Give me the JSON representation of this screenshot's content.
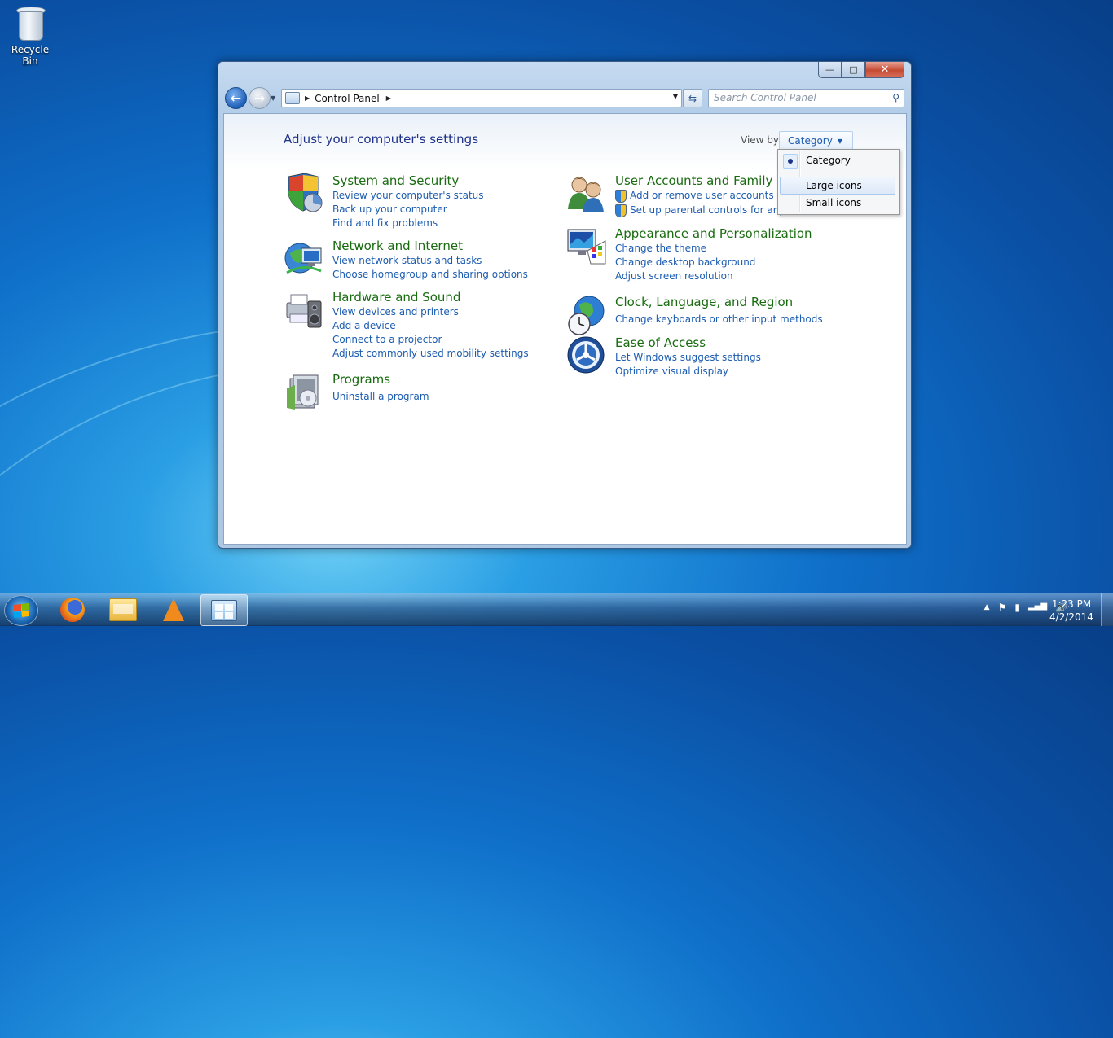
{
  "desktop": {
    "icons": [
      {
        "label": "Recycle Bin",
        "icon": "recycle-bin-icon"
      }
    ]
  },
  "window": {
    "caption_buttons": {
      "minimize": "—",
      "maximize": "□",
      "close": "✕"
    },
    "nav": {
      "back": "←",
      "forward": "→"
    },
    "address": {
      "segments": [
        "Control Panel"
      ],
      "refresh": "⇆"
    },
    "search": {
      "placeholder": "Search Control Panel",
      "icon": "magnifier-icon"
    },
    "content": {
      "title": "Adjust your computer's settings",
      "view_by": {
        "label": "View by:",
        "value": "Category"
      },
      "categories_left": [
        {
          "title": "System and Security",
          "icon": "shield-icon",
          "links": [
            "Review your computer's status",
            "Back up your computer",
            "Find and fix problems"
          ]
        },
        {
          "title": "Network and Internet",
          "icon": "network-globe-icon",
          "links": [
            "View network status and tasks",
            "Choose homegroup and sharing options"
          ]
        },
        {
          "title": "Hardware and Sound",
          "icon": "printer-speaker-icon",
          "links": [
            "View devices and printers",
            "Add a device",
            "Connect to a projector",
            "Adjust commonly used mobility settings"
          ]
        },
        {
          "title": "Programs",
          "icon": "programs-box-icon",
          "links": [
            "Uninstall a program"
          ]
        }
      ],
      "categories_right": [
        {
          "title": "User Accounts and Family Sa",
          "icon": "users-icon",
          "links": [
            "Add or remove user accounts",
            "Set up parental controls for any use"
          ]
        },
        {
          "title": "Appearance and Personalization",
          "icon": "monitor-palette-icon",
          "links": [
            "Change the theme",
            "Change desktop background",
            "Adjust screen resolution"
          ]
        },
        {
          "title": "Clock, Language, and Region",
          "icon": "globe-clock-icon",
          "links": [
            "Change keyboards or other input methods"
          ]
        },
        {
          "title": "Ease of Access",
          "icon": "ease-of-access-icon",
          "links": [
            "Let Windows suggest settings",
            "Optimize visual display"
          ]
        }
      ]
    },
    "view_menu": {
      "items": [
        {
          "label": "Category",
          "selected": true
        },
        {
          "label": "Large icons",
          "hover": true
        },
        {
          "label": "Small icons"
        }
      ]
    }
  },
  "taskbar": {
    "pinned": [
      "firefox-icon",
      "file-explorer-icon",
      "vlc-icon",
      "control-panel-icon"
    ],
    "tray": {
      "show_hidden": "▲",
      "flag": "⚑",
      "power": "▮",
      "signal": "▂▄▆",
      "volume": "🔊"
    },
    "clock": {
      "time": "1:23 PM",
      "date": "4/2/2014"
    }
  },
  "colors": {
    "link": "#1c5cb0",
    "category_title": "#186c0f",
    "page_title": "#1e3287"
  }
}
